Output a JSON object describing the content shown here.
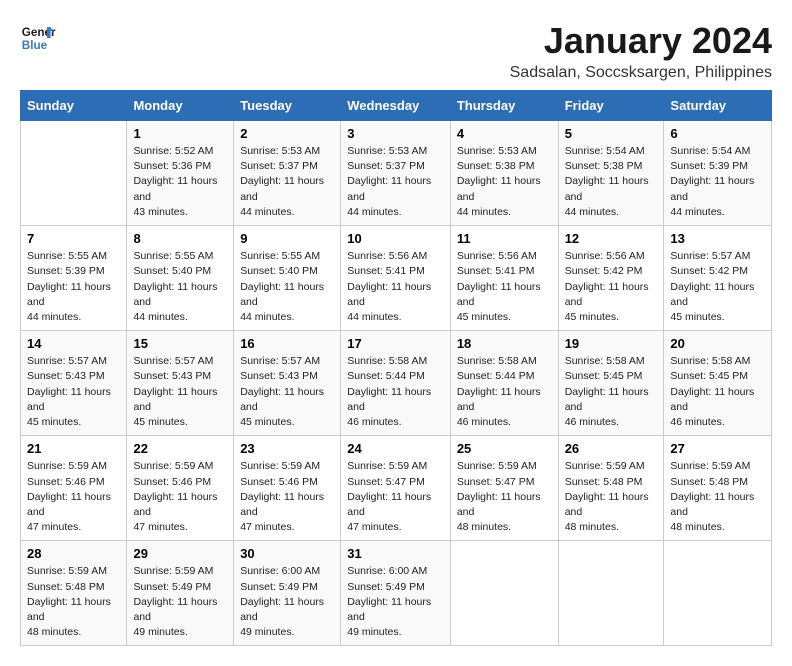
{
  "logo": {
    "line1": "General",
    "line2": "Blue"
  },
  "title": "January 2024",
  "location": "Sadsalan, Soccsksargen, Philippines",
  "days_of_week": [
    "Sunday",
    "Monday",
    "Tuesday",
    "Wednesday",
    "Thursday",
    "Friday",
    "Saturday"
  ],
  "weeks": [
    [
      {
        "day": "",
        "sunrise": "",
        "sunset": "",
        "daylight": ""
      },
      {
        "day": "1",
        "sunrise": "Sunrise: 5:52 AM",
        "sunset": "Sunset: 5:36 PM",
        "daylight": "Daylight: 11 hours and 43 minutes."
      },
      {
        "day": "2",
        "sunrise": "Sunrise: 5:53 AM",
        "sunset": "Sunset: 5:37 PM",
        "daylight": "Daylight: 11 hours and 44 minutes."
      },
      {
        "day": "3",
        "sunrise": "Sunrise: 5:53 AM",
        "sunset": "Sunset: 5:37 PM",
        "daylight": "Daylight: 11 hours and 44 minutes."
      },
      {
        "day": "4",
        "sunrise": "Sunrise: 5:53 AM",
        "sunset": "Sunset: 5:38 PM",
        "daylight": "Daylight: 11 hours and 44 minutes."
      },
      {
        "day": "5",
        "sunrise": "Sunrise: 5:54 AM",
        "sunset": "Sunset: 5:38 PM",
        "daylight": "Daylight: 11 hours and 44 minutes."
      },
      {
        "day": "6",
        "sunrise": "Sunrise: 5:54 AM",
        "sunset": "Sunset: 5:39 PM",
        "daylight": "Daylight: 11 hours and 44 minutes."
      }
    ],
    [
      {
        "day": "7",
        "sunrise": "Sunrise: 5:55 AM",
        "sunset": "Sunset: 5:39 PM",
        "daylight": "Daylight: 11 hours and 44 minutes."
      },
      {
        "day": "8",
        "sunrise": "Sunrise: 5:55 AM",
        "sunset": "Sunset: 5:40 PM",
        "daylight": "Daylight: 11 hours and 44 minutes."
      },
      {
        "day": "9",
        "sunrise": "Sunrise: 5:55 AM",
        "sunset": "Sunset: 5:40 PM",
        "daylight": "Daylight: 11 hours and 44 minutes."
      },
      {
        "day": "10",
        "sunrise": "Sunrise: 5:56 AM",
        "sunset": "Sunset: 5:41 PM",
        "daylight": "Daylight: 11 hours and 44 minutes."
      },
      {
        "day": "11",
        "sunrise": "Sunrise: 5:56 AM",
        "sunset": "Sunset: 5:41 PM",
        "daylight": "Daylight: 11 hours and 45 minutes."
      },
      {
        "day": "12",
        "sunrise": "Sunrise: 5:56 AM",
        "sunset": "Sunset: 5:42 PM",
        "daylight": "Daylight: 11 hours and 45 minutes."
      },
      {
        "day": "13",
        "sunrise": "Sunrise: 5:57 AM",
        "sunset": "Sunset: 5:42 PM",
        "daylight": "Daylight: 11 hours and 45 minutes."
      }
    ],
    [
      {
        "day": "14",
        "sunrise": "Sunrise: 5:57 AM",
        "sunset": "Sunset: 5:43 PM",
        "daylight": "Daylight: 11 hours and 45 minutes."
      },
      {
        "day": "15",
        "sunrise": "Sunrise: 5:57 AM",
        "sunset": "Sunset: 5:43 PM",
        "daylight": "Daylight: 11 hours and 45 minutes."
      },
      {
        "day": "16",
        "sunrise": "Sunrise: 5:57 AM",
        "sunset": "Sunset: 5:43 PM",
        "daylight": "Daylight: 11 hours and 45 minutes."
      },
      {
        "day": "17",
        "sunrise": "Sunrise: 5:58 AM",
        "sunset": "Sunset: 5:44 PM",
        "daylight": "Daylight: 11 hours and 46 minutes."
      },
      {
        "day": "18",
        "sunrise": "Sunrise: 5:58 AM",
        "sunset": "Sunset: 5:44 PM",
        "daylight": "Daylight: 11 hours and 46 minutes."
      },
      {
        "day": "19",
        "sunrise": "Sunrise: 5:58 AM",
        "sunset": "Sunset: 5:45 PM",
        "daylight": "Daylight: 11 hours and 46 minutes."
      },
      {
        "day": "20",
        "sunrise": "Sunrise: 5:58 AM",
        "sunset": "Sunset: 5:45 PM",
        "daylight": "Daylight: 11 hours and 46 minutes."
      }
    ],
    [
      {
        "day": "21",
        "sunrise": "Sunrise: 5:59 AM",
        "sunset": "Sunset: 5:46 PM",
        "daylight": "Daylight: 11 hours and 47 minutes."
      },
      {
        "day": "22",
        "sunrise": "Sunrise: 5:59 AM",
        "sunset": "Sunset: 5:46 PM",
        "daylight": "Daylight: 11 hours and 47 minutes."
      },
      {
        "day": "23",
        "sunrise": "Sunrise: 5:59 AM",
        "sunset": "Sunset: 5:46 PM",
        "daylight": "Daylight: 11 hours and 47 minutes."
      },
      {
        "day": "24",
        "sunrise": "Sunrise: 5:59 AM",
        "sunset": "Sunset: 5:47 PM",
        "daylight": "Daylight: 11 hours and 47 minutes."
      },
      {
        "day": "25",
        "sunrise": "Sunrise: 5:59 AM",
        "sunset": "Sunset: 5:47 PM",
        "daylight": "Daylight: 11 hours and 48 minutes."
      },
      {
        "day": "26",
        "sunrise": "Sunrise: 5:59 AM",
        "sunset": "Sunset: 5:48 PM",
        "daylight": "Daylight: 11 hours and 48 minutes."
      },
      {
        "day": "27",
        "sunrise": "Sunrise: 5:59 AM",
        "sunset": "Sunset: 5:48 PM",
        "daylight": "Daylight: 11 hours and 48 minutes."
      }
    ],
    [
      {
        "day": "28",
        "sunrise": "Sunrise: 5:59 AM",
        "sunset": "Sunset: 5:48 PM",
        "daylight": "Daylight: 11 hours and 48 minutes."
      },
      {
        "day": "29",
        "sunrise": "Sunrise: 5:59 AM",
        "sunset": "Sunset: 5:49 PM",
        "daylight": "Daylight: 11 hours and 49 minutes."
      },
      {
        "day": "30",
        "sunrise": "Sunrise: 6:00 AM",
        "sunset": "Sunset: 5:49 PM",
        "daylight": "Daylight: 11 hours and 49 minutes."
      },
      {
        "day": "31",
        "sunrise": "Sunrise: 6:00 AM",
        "sunset": "Sunset: 5:49 PM",
        "daylight": "Daylight: 11 hours and 49 minutes."
      },
      {
        "day": "",
        "sunrise": "",
        "sunset": "",
        "daylight": ""
      },
      {
        "day": "",
        "sunrise": "",
        "sunset": "",
        "daylight": ""
      },
      {
        "day": "",
        "sunrise": "",
        "sunset": "",
        "daylight": ""
      }
    ]
  ]
}
